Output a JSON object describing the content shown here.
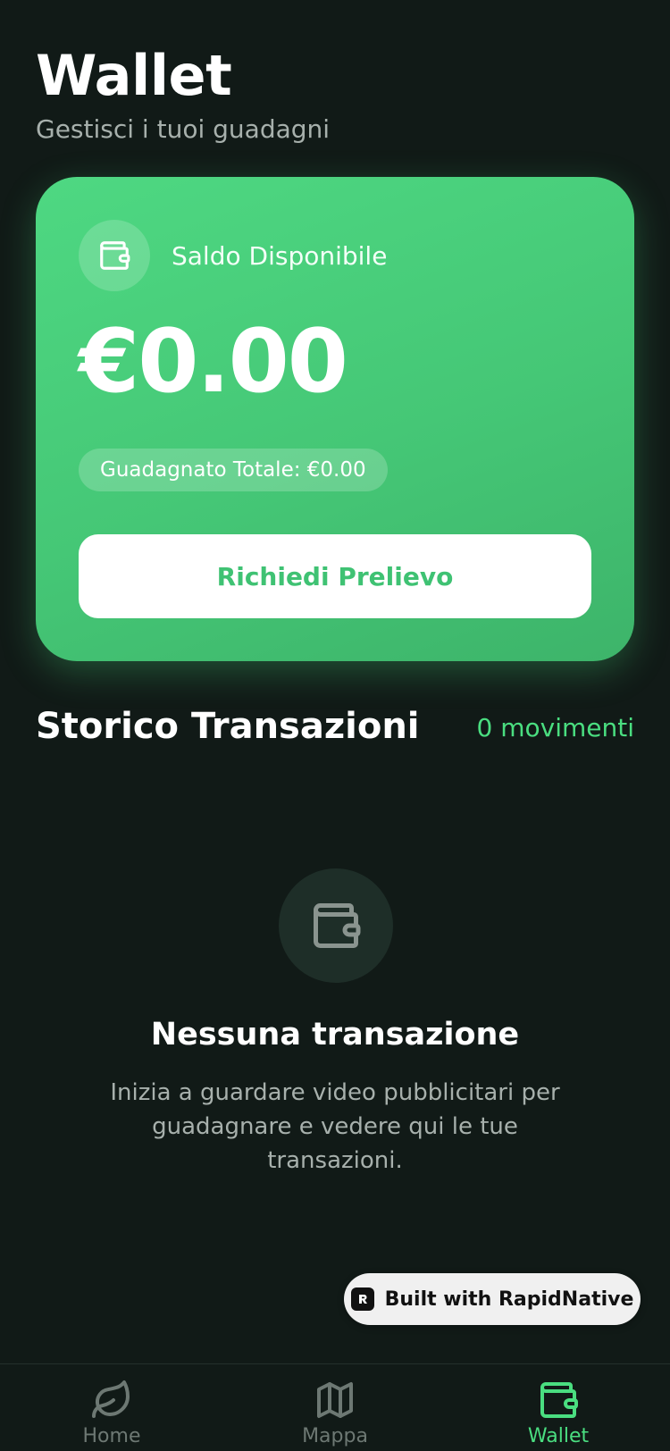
{
  "header": {
    "title": "Wallet",
    "subtitle": "Gestisci i tuoi guadagni"
  },
  "balance_card": {
    "label": "Saldo Disponibile",
    "amount": "€0.00",
    "total_earned": "Guadagnato Totale: €0.00",
    "withdraw_label": "Richiedi Prelievo",
    "icon": "wallet-icon"
  },
  "transactions": {
    "title": "Storico Transazioni",
    "count": "0 movimenti",
    "empty_title": "Nessuna transazione",
    "empty_text": "Inizia a guardare video pubblicitari per guadagnare e vedere qui le tue transazioni.",
    "empty_icon": "wallet-icon"
  },
  "badge": {
    "label": "Built with RapidNative"
  },
  "tab_bar": {
    "tabs": [
      {
        "label": "Home",
        "icon": "leaf-icon",
        "active": false
      },
      {
        "label": "Mappa",
        "icon": "map-icon",
        "active": false
      },
      {
        "label": "Wallet",
        "icon": "wallet-icon",
        "active": true
      }
    ]
  },
  "colors": {
    "background": "#111a17",
    "accent": "#4ade80",
    "card_green": "#45c776",
    "muted_text": "#a7b0ac",
    "inactive_tab": "#6d7873"
  }
}
